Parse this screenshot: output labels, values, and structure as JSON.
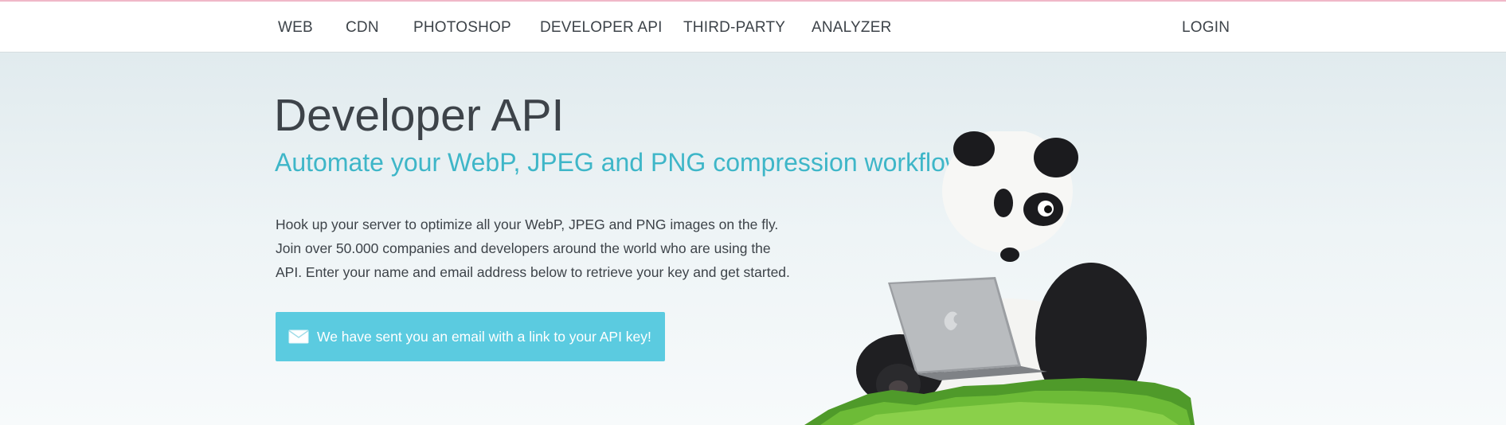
{
  "nav": {
    "items": [
      {
        "label": "WEB"
      },
      {
        "label": "CDN"
      },
      {
        "label": "PHOTOSHOP"
      },
      {
        "label": "DEVELOPER API"
      },
      {
        "label": "THIRD-PARTY"
      },
      {
        "label": "ANALYZER"
      }
    ],
    "login_label": "LOGIN"
  },
  "hero": {
    "title": "Developer API",
    "subtitle": "Automate your WebP, JPEG and PNG compression workflow",
    "description_lines": [
      "Hook up your server to optimize all your WebP, JPEG and PNG images on the fly.",
      "Join over 50.000 companies and developers around the world who are using the",
      "API. Enter your name and email address below to retrieve your key and get started."
    ],
    "alert_text": "We have sent you an email with a link to your API key!",
    "alert_icon": "mail-icon",
    "illustration": "panda-with-laptop-illustration"
  },
  "colors": {
    "accent": "#3eb6c8",
    "alert_bg": "#5bcbe0",
    "text": "#3d4349"
  }
}
